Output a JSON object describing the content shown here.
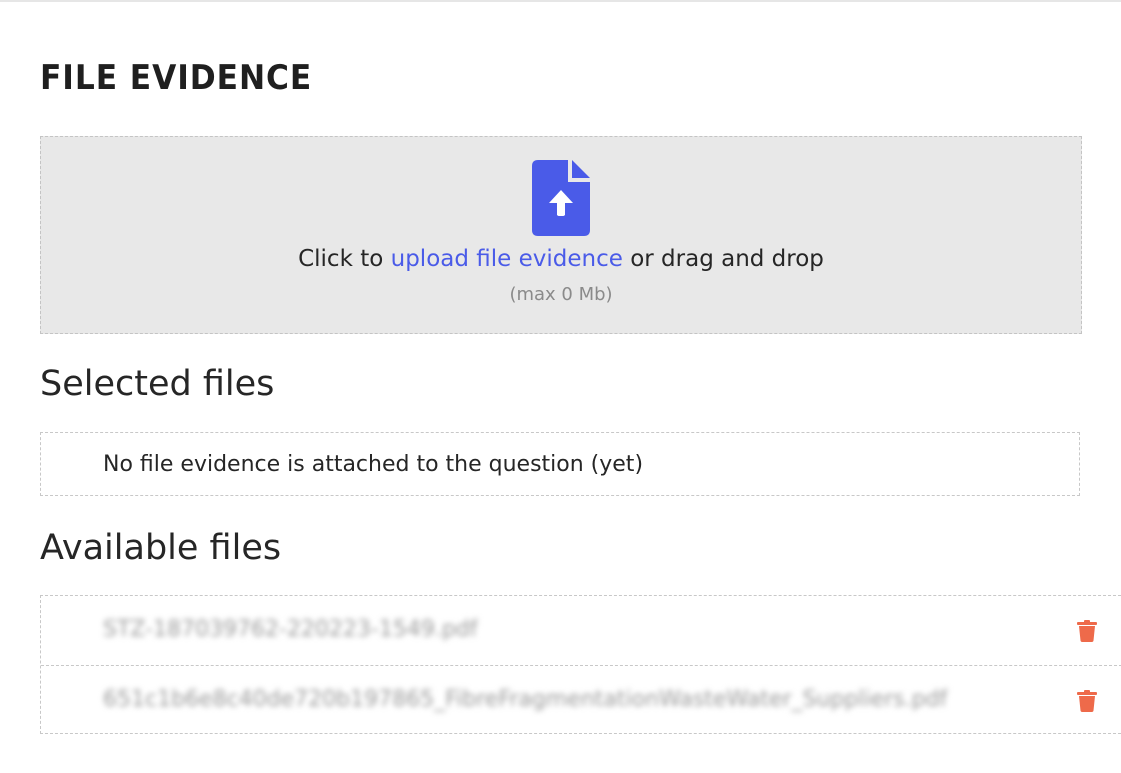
{
  "section": {
    "title": "FILE EVIDENCE"
  },
  "upload": {
    "prefix": "Click to ",
    "link": "upload file evidence",
    "suffix": " or drag and drop",
    "limit": "(max 0 Mb)",
    "icon": "file-upload-icon",
    "accent_color": "#4a5be8"
  },
  "selected": {
    "heading": "Selected files",
    "empty_message": "No file evidence is attached to the question (yet)"
  },
  "available": {
    "heading": "Available files",
    "files": [
      {
        "name": "STZ-187039762-220223-1549.pdf",
        "action_icon": "trash-icon"
      },
      {
        "name": "651c1b6e8c40de720b197865_FibreFragmentationWasteWater_Suppliers.pdf",
        "action_icon": "trash-icon"
      }
    ],
    "delete_color": "#ee6a4a"
  }
}
